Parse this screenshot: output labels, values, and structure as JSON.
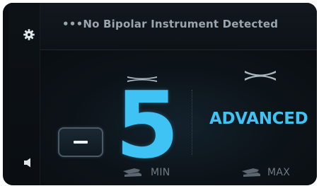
{
  "header": {
    "status_text": "•••No Bipolar Instrument Detected"
  },
  "sidebar": {
    "icons": [
      "gear-icon",
      "speaker-icon"
    ]
  },
  "power": {
    "value": "5",
    "minus_label": "−"
  },
  "mode": {
    "label": "ADVANCED"
  },
  "footer": {
    "left_pedal_label": "MIN",
    "right_pedal_label": "MAX"
  },
  "colors": {
    "accent": "#3ec3f4",
    "background": "#0b0f13",
    "status_text": "#9aa5ad",
    "muted": "#6f7a83"
  }
}
